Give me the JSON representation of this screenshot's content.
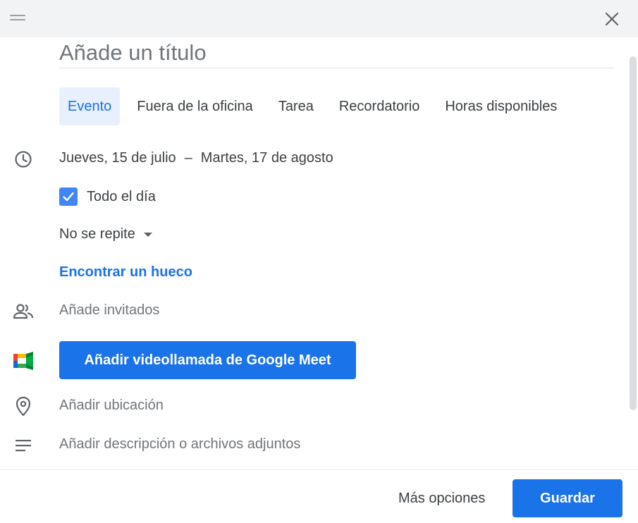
{
  "header": {
    "drag_icon": "drag-handle-icon",
    "close_icon": "close-icon"
  },
  "title_input": {
    "placeholder": "Añade un título",
    "value": ""
  },
  "tabs": [
    {
      "label": "Evento",
      "active": true
    },
    {
      "label": "Fuera de la oficina",
      "active": false
    },
    {
      "label": "Tarea",
      "active": false
    },
    {
      "label": "Recordatorio",
      "active": false
    },
    {
      "label": "Horas disponibles",
      "active": false
    }
  ],
  "datetime": {
    "icon": "clock-icon",
    "start_date": "Jueves, 15 de julio",
    "separator": "–",
    "end_date": "Martes, 17 de agosto"
  },
  "all_day": {
    "label": "Todo el día",
    "checked": true
  },
  "repeat": {
    "value": "No se repite"
  },
  "find_slot": {
    "label": "Encontrar un hueco"
  },
  "guests": {
    "icon": "people-icon",
    "placeholder": "Añade invitados"
  },
  "meet": {
    "icon": "google-meet-icon",
    "button_label": "Añadir videollamada de Google Meet"
  },
  "location": {
    "icon": "location-pin-icon",
    "placeholder": "Añadir ubicación"
  },
  "description": {
    "icon": "notes-icon",
    "placeholder": "Añadir descripción o archivos adjuntos"
  },
  "footer": {
    "more_options_label": "Más opciones",
    "save_label": "Guardar"
  },
  "colors": {
    "accent": "#1a73e8",
    "header_bg": "#f1f3f4",
    "active_tab_bg": "#e8f0fe",
    "checkbox": "#4285f4"
  }
}
